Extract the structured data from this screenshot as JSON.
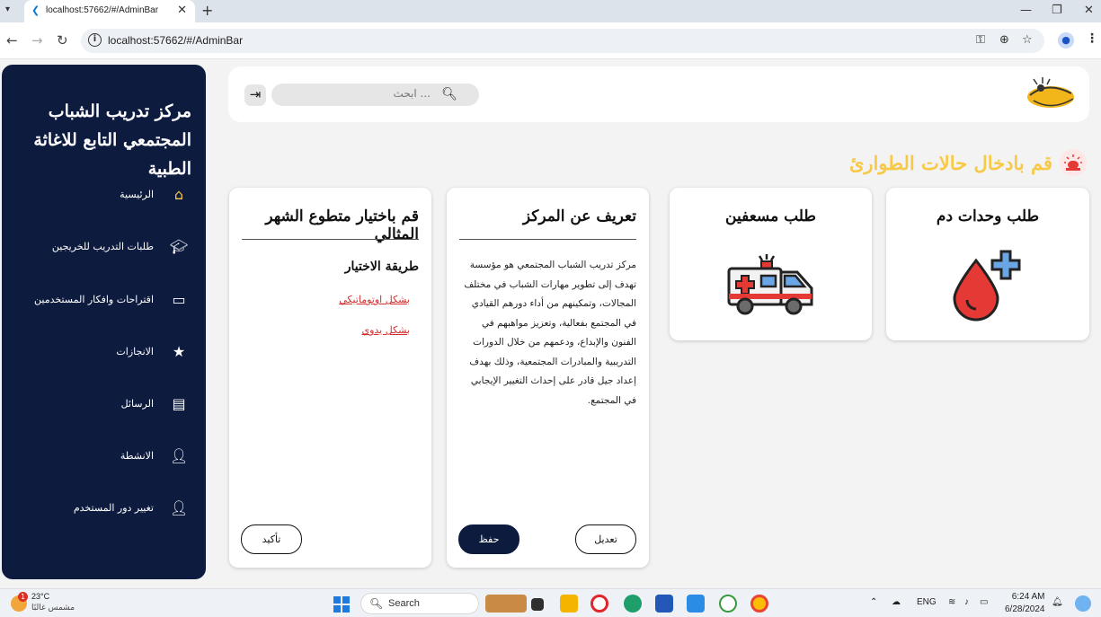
{
  "browser": {
    "tab_title": "localhost:57662/#/AdminBar",
    "url": "localhost:57662/#/AdminBar",
    "new_tab": "+",
    "close": "✕",
    "minimize": "—",
    "restore": "❐",
    "window_close": "✕"
  },
  "sidebar": {
    "title": "مركز تدريب الشباب المجتمعي التابع للاغاثة الطبية",
    "items": [
      {
        "label": "الرئيسية",
        "icon": "home-icon"
      },
      {
        "label": "طلبات التدريب للخريجين",
        "icon": "graduation-cap-icon"
      },
      {
        "label": "اقتراحات وافكار المستخدمين",
        "icon": "message-icon"
      },
      {
        "label": "الانجازات",
        "icon": "star-icon"
      },
      {
        "label": "الرسائل",
        "icon": "contact-card-icon"
      },
      {
        "label": "الانشطة",
        "icon": "add-person-icon"
      },
      {
        "label": "تغيير دور المستخدم",
        "icon": "add-person-icon"
      }
    ]
  },
  "topbar": {
    "search_placeholder": "ابحث ...",
    "logout_icon": "logout-icon"
  },
  "heading": "قم بادخال حالات الطوارئ",
  "cards": {
    "blood": {
      "title": "طلب وحدات دم"
    },
    "ambulance": {
      "title": "طلب مسعفين"
    },
    "about": {
      "title": "تعريف عن المركز",
      "text": "مركز تدريب الشباب المجتمعي هو مؤسسة تهدف إلى تطوير مهارات الشباب في مختلف المجالات، وتمكينهم من أداء دورهم القيادي في المجتمع بفعالية، وتعزيز مواهبهم في الفنون والإبداع، ودعمهم من خلال الدورات التدريبية والمبادرات المجتمعية، وذلك بهدف إعداد جيل قادر على إحداث التغيير الإيجابي في المجتمع.",
      "edit_label": "تعديل",
      "save_label": "حفظ"
    },
    "volunteer": {
      "title": "قم باختيار متطوع الشهر المثالي",
      "method_title": "طريقة الاختيار",
      "auto_label": "بشكل اوتوماتيكي",
      "manual_label": "بشكل يدوي",
      "confirm_label": "تأكيد"
    }
  },
  "taskbar": {
    "weather_temp": "23°C",
    "weather_desc": "مشمس غالبًا",
    "weather_badge": "1",
    "search_label": "Search",
    "language": "ENG",
    "time": "6:24 AM",
    "date": "6/28/2024"
  },
  "colors": {
    "sidebar_bg": "#0d1b3e",
    "heading": "#f7c948",
    "link_red": "#d32f2f"
  }
}
